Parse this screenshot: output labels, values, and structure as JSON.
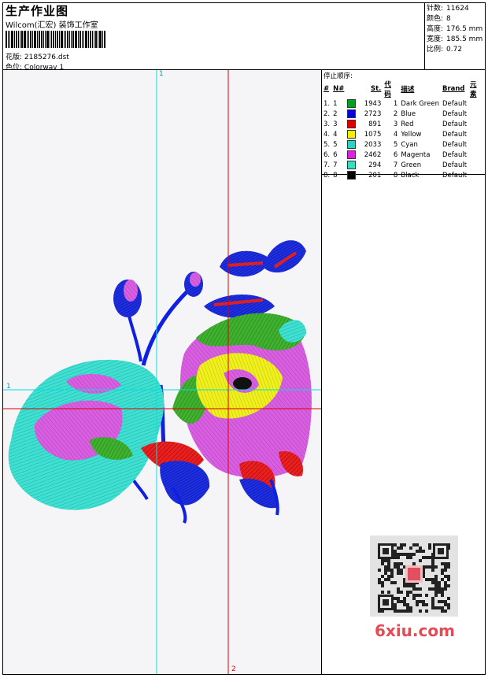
{
  "header": {
    "title": "生产作业图",
    "company": "Wilcom(汇宏) 装饰工作室",
    "design_label": "花版:",
    "design_value": "2185276.dst",
    "colorway_label": "色位:",
    "colorway_value": "Colorway 1"
  },
  "stats": [
    {
      "label": "针数:",
      "value": "11624"
    },
    {
      "label": "颜色:",
      "value": "8"
    },
    {
      "label": "高度:",
      "value": "176.5 mm"
    },
    {
      "label": "宽度:",
      "value": "185.5 mm"
    },
    {
      "label": "比例:",
      "value": "0.72"
    }
  ],
  "stop_sequence": {
    "title": "停止顺序:",
    "headers": [
      "#",
      "N#",
      "St.",
      "代码",
      "描述",
      "Brand",
      "元素"
    ],
    "rows": [
      {
        "idx": "1.",
        "n": "1",
        "color": "#00a020",
        "st": "1943",
        "code": "1",
        "desc": "Dark Green",
        "brand": "Default"
      },
      {
        "idx": "2.",
        "n": "2",
        "color": "#0000e0",
        "st": "2723",
        "code": "2",
        "desc": "Blue",
        "brand": "Default"
      },
      {
        "idx": "3.",
        "n": "3",
        "color": "#e00000",
        "st": "891",
        "code": "3",
        "desc": "Red",
        "brand": "Default"
      },
      {
        "idx": "4.",
        "n": "4",
        "color": "#f0f000",
        "st": "1075",
        "code": "4",
        "desc": "Yellow",
        "brand": "Default"
      },
      {
        "idx": "5.",
        "n": "5",
        "color": "#30d0c0",
        "st": "2033",
        "code": "5",
        "desc": "Cyan",
        "brand": "Default"
      },
      {
        "idx": "6.",
        "n": "6",
        "color": "#e020e0",
        "st": "2462",
        "code": "6",
        "desc": "Magenta",
        "brand": "Default"
      },
      {
        "idx": "7.",
        "n": "7",
        "color": "#30e0c0",
        "st": "294",
        "code": "7",
        "desc": "Green",
        "brand": "Default"
      },
      {
        "idx": "8.",
        "n": "8",
        "color": "#000000",
        "st": "201",
        "code": "8",
        "desc": "Black",
        "brand": "Default"
      }
    ]
  },
  "axes": {
    "v1": "1",
    "h1": "1",
    "v2": "2"
  },
  "watermark": "6xiu.com",
  "colors": {
    "cyan_line": "#00e0e0",
    "red_line": "#e00000",
    "accent_watermark": "#e84a55"
  }
}
